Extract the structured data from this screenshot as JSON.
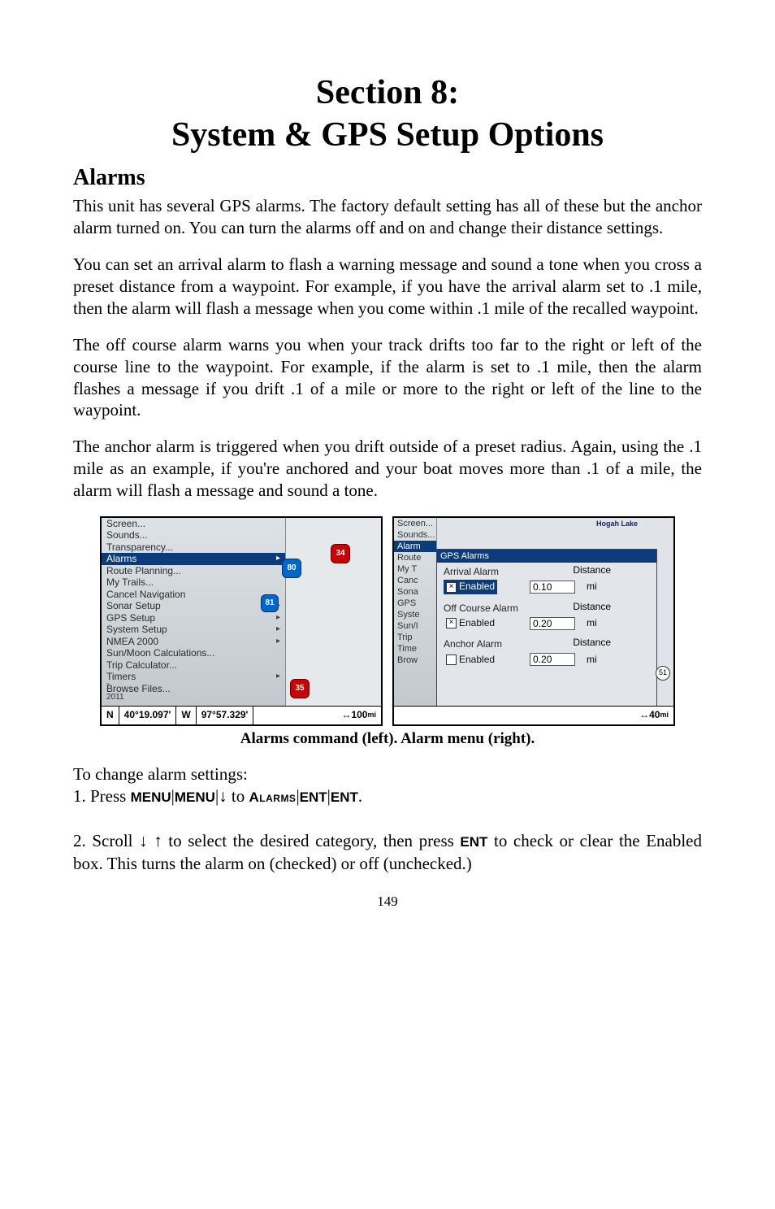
{
  "title_line1": "Section 8:",
  "title_line2": "System & GPS Setup Options",
  "heading_alarms": "Alarms",
  "para1": "This unit has several GPS alarms. The factory default setting has all of these but the anchor alarm turned on. You can turn the alarms off and on and change their distance settings.",
  "para2": "You can set an arrival alarm to flash a warning message and sound a tone when you cross a preset distance from a waypoint. For example, if you have the arrival alarm set to .1 mile, then the alarm will flash a message when you come within .1 mile of the recalled waypoint.",
  "para3": "The off course alarm warns you when your track drifts too far to the right or left of the course line to the waypoint. For example, if the alarm is set to .1 mile, then the alarm flashes a message if you drift .1 of a mile or more to the right or left of the line to the waypoint.",
  "para4": "The anchor alarm is triggered when you drift outside of a preset radius. Again, using the .1 mile as an example, if you're anchored and your boat moves more than .1 of a mile, the alarm will flash a message and sound a tone.",
  "caption": "Alarms command (left). Alarm menu (right).",
  "left_menu": [
    "Screen...",
    "Sounds...",
    "Transparency...",
    "Alarms",
    "Route Planning...",
    "My Trails...",
    "Cancel Navigation",
    "Sonar Setup",
    "GPS Setup",
    "System Setup",
    "NMEA 2000",
    "Sun/Moon Calculations...",
    "Trip Calculator...",
    "Timers",
    "Browse Files..."
  ],
  "left_submenu_idx": [
    3,
    7,
    8,
    9,
    10,
    13
  ],
  "left_highlight_idx": 3,
  "shields": {
    "s34": "34",
    "s80": "80",
    "s81": "81",
    "s35": "35"
  },
  "status": {
    "n": "N",
    "lat": "40°19.097'",
    "w": "W",
    "lon": "97°57.329'",
    "zoom": "100",
    "zoom_unit": "mi"
  },
  "right_menu_fragments": [
    "Screen...",
    "Sounds...",
    "Alarm",
    "Route",
    "My T",
    "Canc",
    "Sona",
    "GPS",
    "Syste",
    "Sun/I",
    "Trip",
    "Time",
    "Brow"
  ],
  "right_menu_hl_idx": 2,
  "lake_label": "Hogah Lake",
  "dialog_title": "GPS Alarms",
  "groups": {
    "arrival": {
      "label": "Arrival Alarm",
      "enabled_label": "Enabled",
      "checked": true,
      "selected": true,
      "distance_label": "Distance",
      "value": "0.10",
      "unit": "mi"
    },
    "offcourse": {
      "label": "Off Course Alarm",
      "enabled_label": "Enabled",
      "checked": true,
      "selected": false,
      "distance_label": "Distance",
      "value": "0.20",
      "unit": "mi"
    },
    "anchor": {
      "label": "Anchor Alarm",
      "enabled_label": "Enabled",
      "checked": false,
      "selected": false,
      "distance_label": "Distance",
      "value": "0.20",
      "unit": "mi"
    }
  },
  "right_status": {
    "zoom": "40",
    "unit": "mi"
  },
  "hwy51": "51",
  "steps_intro": "To change alarm settings:",
  "step1_prefix": "1. Press ",
  "kbd": {
    "menu": "MENU",
    "ent": "ENT",
    "alarms": "Alarms"
  },
  "step2_prefix": "2. Scroll ",
  "step2_mid": " to select the desired category, then press ",
  "step2_tail": " to check or clear the Enabled box. This turns the alarm on (checked) or off (unchecked.)",
  "step1_mid": " to ",
  "page_number": "149"
}
